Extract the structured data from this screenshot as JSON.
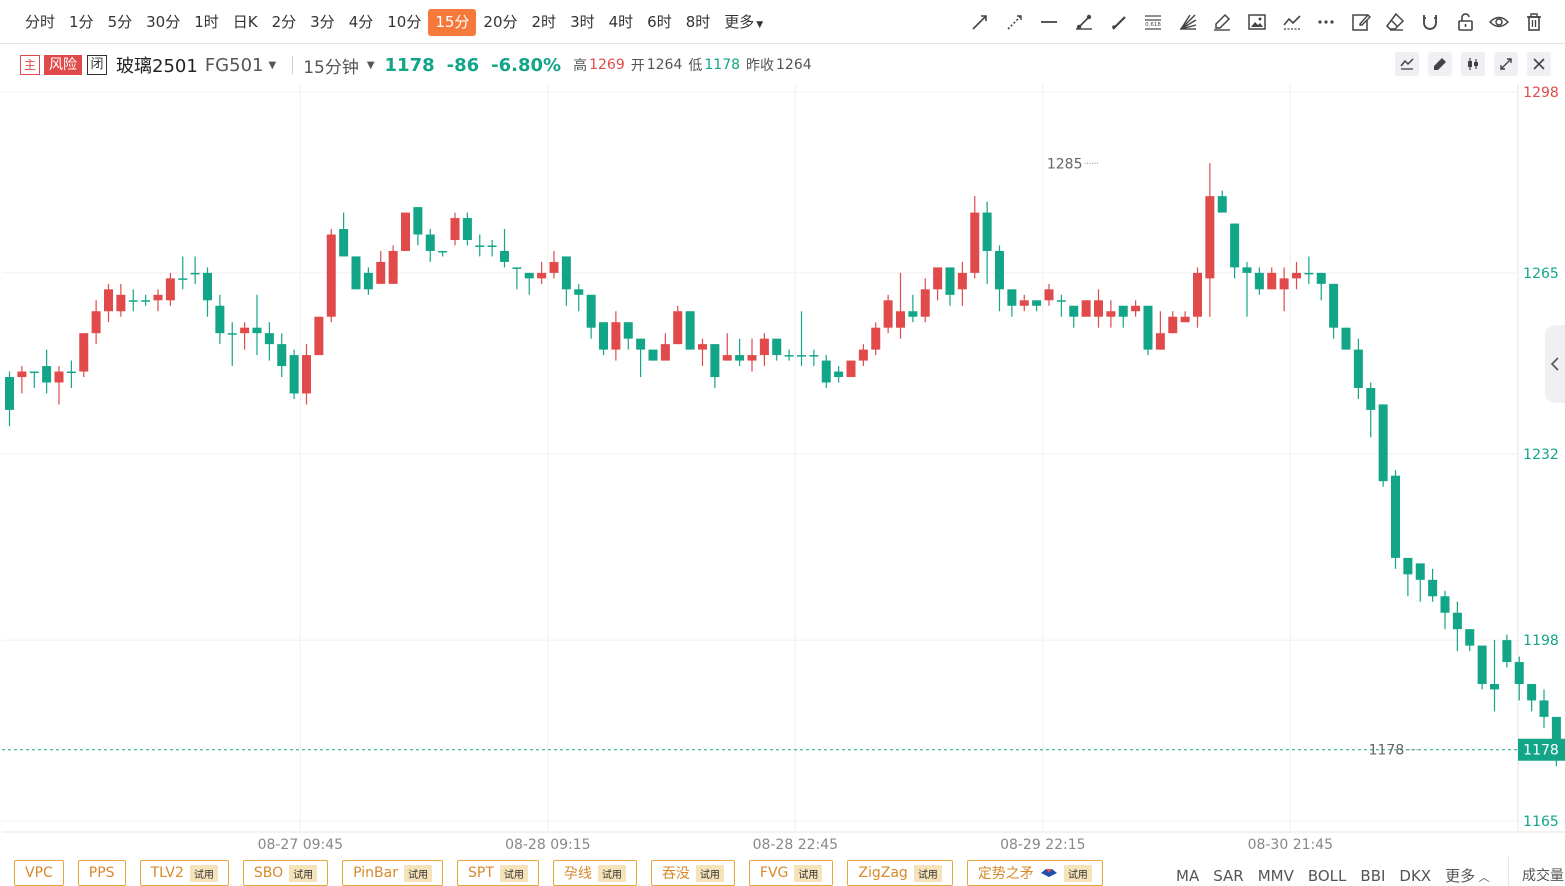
{
  "periods": [
    {
      "label": "分时"
    },
    {
      "label": "1分"
    },
    {
      "label": "5分"
    },
    {
      "label": "30分"
    },
    {
      "label": "1时"
    },
    {
      "label": "日K"
    },
    {
      "label": "2分"
    },
    {
      "label": "3分"
    },
    {
      "label": "4分"
    },
    {
      "label": "10分"
    },
    {
      "label": "15分",
      "active": true
    },
    {
      "label": "20分"
    },
    {
      "label": "2时"
    },
    {
      "label": "3时"
    },
    {
      "label": "4时"
    },
    {
      "label": "6时"
    },
    {
      "label": "8时"
    },
    {
      "label": "更多",
      "dropdown": true
    }
  ],
  "drawing_tools": [
    "ray-line-icon",
    "dashed-ray-icon",
    "horizontal-line-icon",
    "segment-icon",
    "pen-icon",
    "fibonacci-icon",
    "fan-icon",
    "brush-icon",
    "image-icon",
    "trend-chart-icon",
    "more-dots-icon",
    "edit-icon",
    "eraser-icon",
    "magnet-icon",
    "unlock-icon",
    "eye-icon",
    "trash-icon"
  ],
  "fib_label": "0.618",
  "instrument": {
    "tag_main": "主",
    "tag_risk": "风险",
    "tag_closed": "闭",
    "name": "玻璃2501",
    "code": "FG501",
    "interval": "15分钟"
  },
  "quote": {
    "price": "1178",
    "change": "-86",
    "change_pct": "-6.80%",
    "high_label": "高",
    "high": "1269",
    "open_label": "开",
    "open": "1264",
    "low_label": "低",
    "low": "1178",
    "prev_close_label": "昨收",
    "prev_close": "1264"
  },
  "colors": {
    "up": "#e04a4a",
    "down": "#12a588",
    "accent": "#f5793a",
    "indicator": "#d9892a"
  },
  "indicators": [
    {
      "label": "VPC",
      "trial": false
    },
    {
      "label": "PPS",
      "trial": false
    },
    {
      "label": "TLV2",
      "trial": true
    },
    {
      "label": "SBO",
      "trial": true
    },
    {
      "label": "PinBar",
      "trial": true
    },
    {
      "label": "SPT",
      "trial": true
    },
    {
      "label": "孕线",
      "trial": true
    },
    {
      "label": "吞没",
      "trial": true
    },
    {
      "label": "FVG",
      "trial": true
    },
    {
      "label": "ZigZag",
      "trial": true
    },
    {
      "label": "定势之矛",
      "trial": true,
      "diamond": true
    }
  ],
  "trial_label": "试用",
  "indicator_links": [
    "MA",
    "SAR",
    "MMV",
    "BOLL",
    "BBI",
    "DKX"
  ],
  "more_label": "更多",
  "volume_label": "成交量",
  "chart_data": {
    "type": "candlestick",
    "ylim": [
      1162,
      1300
    ],
    "y_ticks": [
      {
        "value": 1298,
        "label": "1298",
        "color": "up"
      },
      {
        "value": 1265,
        "label": "1265",
        "color": "down"
      },
      {
        "value": 1232,
        "label": "1232",
        "color": "down"
      },
      {
        "value": 1198,
        "label": "1198",
        "color": "down"
      },
      {
        "value": 1165,
        "label": "1165",
        "color": "down"
      }
    ],
    "x_ticks": [
      {
        "index": 23.5,
        "label": "08-27 09:45"
      },
      {
        "index": 43.5,
        "label": "08-28 09:15"
      },
      {
        "index": 63.5,
        "label": "08-28 22:45"
      },
      {
        "index": 83.5,
        "label": "08-29 22:15"
      },
      {
        "index": 103.5,
        "label": "08-30 21:45"
      }
    ],
    "last_price": {
      "value": 1178,
      "label": "1178"
    },
    "annotations": [
      {
        "index": 88,
        "value": 1285,
        "label": "1285",
        "position": "high"
      },
      {
        "index": 114,
        "value": 1178,
        "label": "1178",
        "position": "low"
      }
    ],
    "candles": [
      [
        1246,
        1240,
        1247,
        1237
      ],
      [
        1246,
        1247,
        1248,
        1243
      ],
      [
        1247,
        1247,
        1247,
        1244
      ],
      [
        1248,
        1245,
        1251,
        1243
      ],
      [
        1245,
        1247,
        1248,
        1241
      ],
      [
        1247,
        1247,
        1249,
        1244
      ],
      [
        1247,
        1254,
        1254,
        1246
      ],
      [
        1254,
        1258,
        1260,
        1252
      ],
      [
        1258,
        1262,
        1263,
        1256
      ],
      [
        1258,
        1261,
        1263,
        1257
      ],
      [
        1260,
        1260,
        1262,
        1258
      ],
      [
        1260,
        1260,
        1261,
        1259
      ],
      [
        1260,
        1261,
        1262,
        1258
      ],
      [
        1260,
        1264,
        1265,
        1259
      ],
      [
        1264,
        1264,
        1268,
        1262
      ],
      [
        1265,
        1265,
        1268,
        1263
      ],
      [
        1265,
        1260,
        1266,
        1257
      ],
      [
        1259,
        1254,
        1261,
        1252
      ],
      [
        1254,
        1254,
        1256,
        1248
      ],
      [
        1254,
        1255,
        1256,
        1251
      ],
      [
        1255,
        1254,
        1261,
        1250
      ],
      [
        1254,
        1252,
        1256,
        1249
      ],
      [
        1252,
        1248,
        1254,
        1246
      ],
      [
        1250,
        1243,
        1251,
        1242
      ],
      [
        1243,
        1250,
        1252,
        1241
      ],
      [
        1250,
        1257,
        1257,
        1250
      ],
      [
        1257,
        1272,
        1273,
        1256
      ],
      [
        1273,
        1268,
        1276,
        1268
      ],
      [
        1268,
        1262,
        1268,
        1262
      ],
      [
        1265,
        1262,
        1266,
        1261
      ],
      [
        1263,
        1267,
        1269,
        1263
      ],
      [
        1263,
        1269,
        1270,
        1263
      ],
      [
        1269,
        1276,
        1276,
        1269
      ],
      [
        1277,
        1272,
        1276,
        1270
      ],
      [
        1272,
        1269,
        1273,
        1267
      ],
      [
        1269,
        1269,
        1269,
        1268
      ],
      [
        1271,
        1275,
        1276,
        1270
      ],
      [
        1275,
        1271,
        1276,
        1270
      ],
      [
        1270,
        1270,
        1272,
        1268
      ],
      [
        1270,
        1270,
        1271,
        1268
      ],
      [
        1269,
        1267,
        1273,
        1266
      ],
      [
        1266,
        1266,
        1265,
        1262
      ],
      [
        1265,
        1264,
        1265,
        1261
      ],
      [
        1264,
        1265,
        1267,
        1263
      ],
      [
        1265,
        1267,
        1269,
        1264
      ],
      [
        1268,
        1262,
        1268,
        1259
      ],
      [
        1262,
        1261,
        1263,
        1258
      ],
      [
        1261,
        1255,
        1261,
        1253
      ],
      [
        1256,
        1251,
        1256,
        1250
      ],
      [
        1251,
        1256,
        1258,
        1249
      ],
      [
        1256,
        1253,
        1256,
        1251
      ],
      [
        1253,
        1251,
        1253,
        1246
      ],
      [
        1251,
        1249,
        1251,
        1249
      ],
      [
        1249,
        1252,
        1254,
        1249
      ],
      [
        1252,
        1258,
        1259,
        1252
      ],
      [
        1258,
        1251,
        1258,
        1251
      ],
      [
        1251,
        1252,
        1253,
        1248
      ],
      [
        1252,
        1246,
        1250,
        1244
      ],
      [
        1249,
        1250,
        1254,
        1249
      ],
      [
        1250,
        1249,
        1253,
        1248
      ],
      [
        1249,
        1250,
        1253,
        1247
      ],
      [
        1250,
        1253,
        1254,
        1248
      ],
      [
        1253,
        1250,
        1253,
        1249
      ],
      [
        1250,
        1250,
        1251,
        1249
      ],
      [
        1250,
        1250,
        1258,
        1248
      ],
      [
        1250,
        1250,
        1251,
        1248
      ],
      [
        1249,
        1245,
        1250,
        1244
      ],
      [
        1247,
        1246,
        1248,
        1245
      ],
      [
        1246,
        1249,
        1249,
        1246
      ],
      [
        1249,
        1251,
        1252,
        1248
      ],
      [
        1251,
        1255,
        1256,
        1250
      ],
      [
        1255,
        1260,
        1261,
        1254
      ],
      [
        1255,
        1258,
        1265,
        1253
      ],
      [
        1258,
        1257,
        1261,
        1256
      ],
      [
        1257,
        1262,
        1264,
        1256
      ],
      [
        1262,
        1266,
        1265,
        1260
      ],
      [
        1266,
        1261,
        1262,
        1259
      ],
      [
        1262,
        1265,
        1267,
        1259
      ],
      [
        1265,
        1276,
        1279,
        1264
      ],
      [
        1276,
        1269,
        1278,
        1263
      ],
      [
        1269,
        1262,
        1270,
        1258
      ],
      [
        1262,
        1259,
        1262,
        1257
      ],
      [
        1259,
        1260,
        1261,
        1258
      ],
      [
        1260,
        1259,
        1260,
        1258
      ],
      [
        1260,
        1262,
        1263,
        1259
      ],
      [
        1260,
        1260,
        1261,
        1257
      ],
      [
        1259,
        1257,
        1259,
        1255
      ],
      [
        1257,
        1260,
        1260,
        1257
      ],
      [
        1257,
        1260,
        1262,
        1255
      ],
      [
        1257,
        1258,
        1260,
        1255
      ],
      [
        1259,
        1257,
        1259,
        1255
      ],
      [
        1258,
        1259,
        1260,
        1257
      ],
      [
        1259,
        1251,
        1259,
        1250
      ],
      [
        1251,
        1254,
        1258,
        1252
      ],
      [
        1254,
        1257,
        1258,
        1255
      ],
      [
        1256,
        1257,
        1258,
        1257
      ],
      [
        1257,
        1265,
        1266,
        1255
      ],
      [
        1264,
        1279,
        1285,
        1257
      ],
      [
        1279,
        1276,
        1280,
        1276
      ],
      [
        1274,
        1266,
        1272,
        1264
      ],
      [
        1266,
        1265,
        1267,
        1257
      ],
      [
        1265,
        1262,
        1266,
        1261
      ],
      [
        1262,
        1265,
        1266,
        1262
      ],
      [
        1262,
        1264,
        1266,
        1258
      ],
      [
        1264,
        1265,
        1267,
        1262
      ],
      [
        1265,
        1265,
        1268,
        1263
      ],
      [
        1265,
        1263,
        1265,
        1260
      ],
      [
        1263,
        1255,
        1263,
        1253
      ],
      [
        1255,
        1251,
        1253,
        1251
      ],
      [
        1251,
        1244,
        1253,
        1242
      ],
      [
        1244,
        1240,
        1245,
        1235
      ],
      [
        1241,
        1227,
        1241,
        1226
      ],
      [
        1228,
        1213,
        1229,
        1211
      ],
      [
        1213,
        1210,
        1213,
        1206
      ],
      [
        1212,
        1209,
        1210,
        1205
      ],
      [
        1209,
        1206,
        1211,
        1205
      ],
      [
        1206,
        1203,
        1207,
        1200
      ],
      [
        1203,
        1200,
        1205,
        1196
      ],
      [
        1200,
        1197,
        1200,
        1196
      ],
      [
        1197,
        1190,
        1197,
        1189
      ],
      [
        1190,
        1189,
        1198,
        1185
      ],
      [
        1198,
        1194,
        1199,
        1193
      ],
      [
        1194,
        1190,
        1195,
        1187
      ],
      [
        1190,
        1187,
        1190,
        1185
      ],
      [
        1187,
        1184,
        1189,
        1182
      ],
      [
        1184,
        1179,
        1182,
        1175
      ],
      [
        1180,
        1178,
        1184,
        1176
      ]
    ]
  }
}
